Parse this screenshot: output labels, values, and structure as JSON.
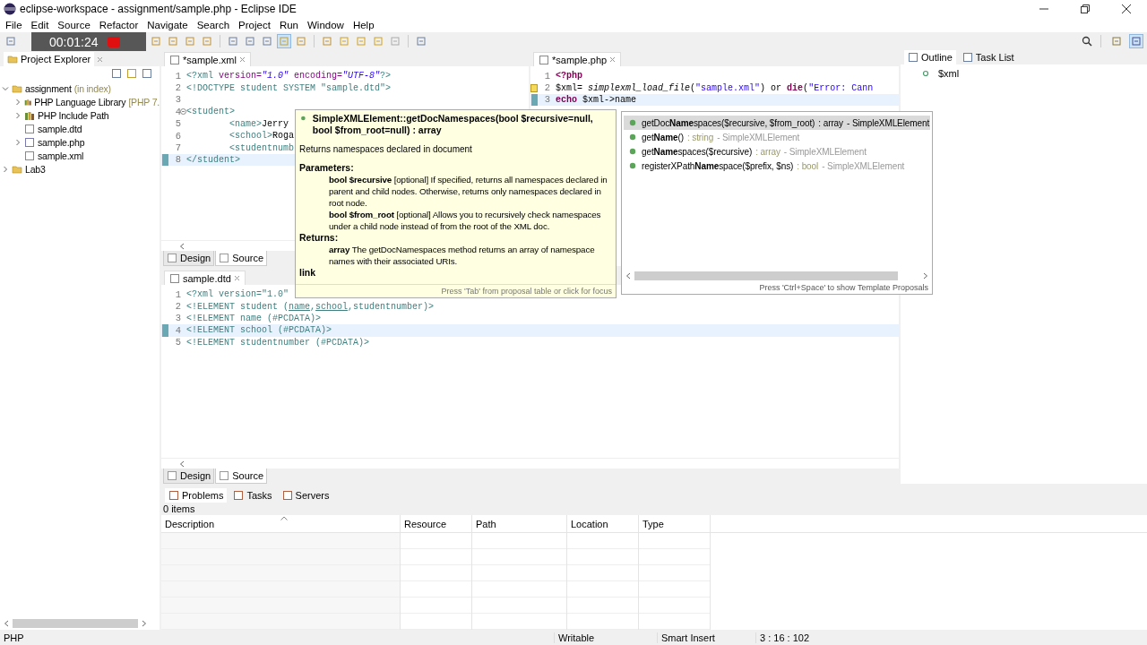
{
  "window": {
    "title": "eclipse-workspace - assignment/sample.php - Eclipse IDE"
  },
  "menu": [
    "File",
    "Edit",
    "Source",
    "Refactor",
    "Navigate",
    "Search",
    "Project",
    "Run",
    "Window",
    "Help"
  ],
  "toolbar": {
    "toggle_on": true,
    "perspectives": [
      {
        "selected": false
      },
      {
        "selected": true
      }
    ]
  },
  "recording_overlay": {
    "time": "00:01:24"
  },
  "project_explorer": {
    "title": "Project Explorer",
    "tree": [
      {
        "label": "assignment",
        "decoration": "(in index)",
        "kind": "project",
        "expanded": true,
        "children": [
          {
            "label": "PHP Language Library",
            "decoration": "[PHP 7.",
            "kind": "library",
            "expanded": false
          },
          {
            "label": "PHP Include Path",
            "kind": "library",
            "expanded": false
          },
          {
            "label": "sample.dtd",
            "kind": "xfile"
          },
          {
            "label": "sample.php",
            "kind": "pfile",
            "expanded": false
          },
          {
            "label": "sample.xml",
            "kind": "xfile"
          }
        ]
      },
      {
        "label": "Lab3",
        "kind": "project",
        "expanded": false
      }
    ]
  },
  "xml_editor": {
    "tab": "*sample.xml",
    "bottom_tabs": [
      {
        "label": "Design",
        "selected": false
      },
      {
        "label": "Source",
        "selected": true
      }
    ],
    "lines": [
      {
        "n": "1",
        "segs": [
          {
            "t": "<?xml ",
            "kind": "tag"
          },
          {
            "t": "version=",
            "kind": "attr"
          },
          {
            "t": "\"1.0\"",
            "kind": "value"
          },
          {
            "t": " encoding=",
            "kind": "attr"
          },
          {
            "t": "\"UTF-8\"",
            "kind": "value"
          },
          {
            "t": "?>",
            "kind": "tag"
          }
        ]
      },
      {
        "n": "2",
        "segs": [
          {
            "t": "<!DOCTYPE student SYSTEM \"sample.dtd\">",
            "kind": "tag"
          }
        ]
      },
      {
        "n": "3"
      },
      {
        "n": "4",
        "fold": true,
        "segs": [
          {
            "t": "<student>",
            "kind": "tag"
          }
        ]
      },
      {
        "n": "5",
        "indent": true,
        "segs": [
          {
            "t": "<name>",
            "kind": "tag"
          },
          {
            "t": "Jerry",
            "kind": "text"
          }
        ]
      },
      {
        "n": "6",
        "indent": true,
        "segs": [
          {
            "t": "<school>",
            "kind": "tag"
          },
          {
            "t": "Roga",
            "kind": "text"
          }
        ]
      },
      {
        "n": "7",
        "indent": true,
        "segs": [
          {
            "t": "<studentnumb",
            "kind": "tag"
          }
        ]
      },
      {
        "n": "8",
        "current": true,
        "segs": [
          {
            "t": "</student>",
            "kind": "tag"
          }
        ]
      }
    ]
  },
  "php_editor": {
    "tab": "*sample.php",
    "lines": [
      {
        "n": "1",
        "segs": [
          {
            "t": "<?php",
            "kind": "keyword"
          }
        ]
      },
      {
        "n": "2",
        "warning": true,
        "segs": [
          {
            "t": "$xml= ",
            "kind": "text"
          },
          {
            "t": "simplexml_load_file",
            "kind": "func"
          },
          {
            "t": "(",
            "kind": "text"
          },
          {
            "t": "\"sample.xml\"",
            "kind": "string"
          },
          {
            "t": ") or ",
            "kind": "text"
          },
          {
            "t": "die",
            "kind": "keyword"
          },
          {
            "t": "(",
            "kind": "text"
          },
          {
            "t": "\"Error: Cann",
            "kind": "string"
          }
        ]
      },
      {
        "n": "3",
        "current": true,
        "segs": [
          {
            "t": "echo",
            "kind": "keyword"
          },
          {
            "t": " $xml->name",
            "kind": "text"
          }
        ]
      }
    ]
  },
  "dtd_editor": {
    "tab": "sample.dtd",
    "bottom_tabs": [
      {
        "label": "Design",
        "selected": false
      },
      {
        "label": "Source",
        "selected": true
      }
    ],
    "lines": [
      {
        "n": "1",
        "segs": [
          {
            "t": "<?xml version=\"1.0\"",
            "kind": "tag"
          }
        ]
      },
      {
        "n": "2",
        "segs": [
          {
            "t": "<!ELEMENT student (",
            "kind": "tag"
          },
          {
            "t": "name",
            "kind": "ref"
          },
          {
            "t": ",",
            "kind": "tag"
          },
          {
            "t": "school",
            "kind": "ref"
          },
          {
            "t": ",studentnumber)>",
            "kind": "tag"
          }
        ]
      },
      {
        "n": "3",
        "segs": [
          {
            "t": "<!ELEMENT name (#PCDATA)>",
            "kind": "tag"
          }
        ]
      },
      {
        "n": "4",
        "current": true,
        "segs": [
          {
            "t": "<!ELEMENT school (#PCDATA)>",
            "kind": "tag"
          }
        ]
      },
      {
        "n": "5",
        "segs": [
          {
            "t": "<!ELEMENT studentnumber (#PCDATA)>",
            "kind": "tag"
          }
        ]
      }
    ]
  },
  "doc_popup": {
    "title": "SimpleXMLElement::getDocNamespaces(bool $recursive=null, bool $from_root=null) : array",
    "summary": "Returns namespaces declared in document",
    "sections": [
      {
        "heading": "Parameters:",
        "items": [
          "**bool $recursive** [optional] If specified, returns all namespaces declared in parent and child nodes. Otherwise, returns only namespaces declared in root node.",
          "**bool $from_root** [optional] Allows you to recursively check namespaces under a child node instead of from the root of the XML doc."
        ]
      },
      {
        "heading": "Returns:",
        "items": [
          "**array** The getDocNamespaces method returns an array of namespace names with their associated URIs."
        ]
      }
    ],
    "link": "link",
    "footer": "Press 'Tab' from proposal table or click for focus"
  },
  "proposals": {
    "items": [
      {
        "signature": "getDoc**Name**spaces($recursive, $from_root)",
        "type": ": array",
        "owner": "- SimpleXMLElement",
        "selected": true
      },
      {
        "signature": "get**Name**()",
        "type": ": string",
        "owner": "- SimpleXMLElement",
        "selected": false
      },
      {
        "signature": "get**Name**spaces($recursive)",
        "type": ": array",
        "owner": "- SimpleXMLElement",
        "selected": false
      },
      {
        "signature": "registerXPath**Name**space($prefix, $ns)",
        "type": ": bool",
        "owner": "- SimpleXMLElement",
        "selected": false
      }
    ],
    "footer": "Press 'Ctrl+Space' to show Template Proposals"
  },
  "outline": {
    "tabs": [
      {
        "label": "Outline",
        "selected": true
      },
      {
        "label": "Task List",
        "selected": false
      }
    ],
    "items": [
      "$xml"
    ]
  },
  "problems": {
    "tabs": [
      {
        "label": "Problems",
        "selected": true
      },
      {
        "label": "Tasks",
        "selected": false
      },
      {
        "label": "Servers",
        "selected": false
      }
    ],
    "count": "0 items",
    "columns": [
      {
        "label": "Description",
        "sorted": true
      },
      {
        "label": "Resource",
        "sorted": false
      },
      {
        "label": "Path",
        "sorted": false
      },
      {
        "label": "Location",
        "sorted": false
      },
      {
        "label": "Type",
        "sorted": false
      }
    ]
  },
  "status_bar": {
    "language": "PHP",
    "mode": "Writable",
    "insert": "Smart Insert",
    "position": "3 : 16 : 102"
  }
}
